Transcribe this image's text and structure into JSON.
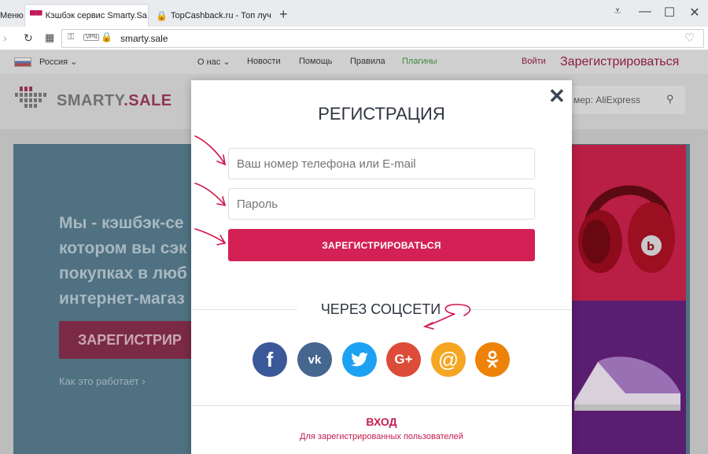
{
  "browser": {
    "menu_label": "Меню",
    "tabs": [
      {
        "label": "Кэшбэк сервис Smarty.Sa",
        "active": true
      },
      {
        "label": "TopCashback.ru - Топ луч",
        "active": false
      }
    ],
    "new_tab": "+",
    "url": "smarty.sale",
    "vpn_badge": "VPN"
  },
  "site": {
    "region": "Россия",
    "nav": [
      "О нас",
      "Новости",
      "Помощь",
      "Правила",
      "Плагины"
    ],
    "login": "Войти",
    "register": "Зарегистрироваться",
    "logo_text": "SMARTY",
    "logo_dot": ".",
    "logo_sale": "SALE",
    "search_placeholder": "мер: AliExpress",
    "hero_lines": [
      "Мы - кэшбэк-се",
      "котором вы сэк",
      "покупках в люб",
      "интернет-магаз"
    ],
    "hero_button": "ЗАРЕГИСТРИР",
    "how_it_works": "Как это работает"
  },
  "modal": {
    "title": "РЕГИСТРАЦИЯ",
    "phone_placeholder": "Ваш номер телефона или E-mail",
    "password_placeholder": "Пароль",
    "submit": "ЗАРЕГИСТРИРОВАТЬСЯ",
    "social_heading": "ЧЕРЕЗ СОЦСЕТИ",
    "social": [
      {
        "name": "facebook",
        "glyph": "f",
        "color": "#3b5998"
      },
      {
        "name": "vk",
        "glyph": "vk",
        "color": "#45668e"
      },
      {
        "name": "twitter",
        "glyph": "t",
        "color": "#1da1f2"
      },
      {
        "name": "google-plus",
        "glyph": "G+",
        "color": "#dd4b39"
      },
      {
        "name": "mail",
        "glyph": "@",
        "color": "#f5a623"
      },
      {
        "name": "odnoklassniki",
        "glyph": "ok",
        "color": "#ee8208"
      }
    ],
    "login_title": "ВХОД",
    "login_subtitle": "Для зарегистрированных пользователей"
  },
  "colors": {
    "accent": "#d32155",
    "hero": "#4f7181"
  }
}
